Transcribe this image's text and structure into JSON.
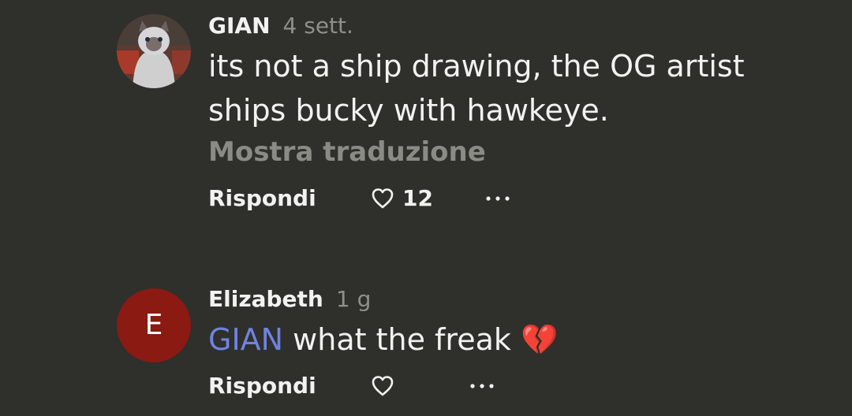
{
  "comments": [
    {
      "username": "GIAN",
      "time": "4 sett.",
      "avatar": "cat-photo",
      "body_lines": [
        "its not a ship drawing, the OG artist",
        "ships bucky with hawkeye."
      ],
      "translate": "Mostra traduzione",
      "reply_label": "Rispondi",
      "like_count": "12"
    },
    {
      "username": "Elizabeth",
      "time": "1 g",
      "avatar_letter": "E",
      "avatar_color": "#8a1a12",
      "mention": "GIAN",
      "body_text": " what the freak ",
      "emoji": "💔",
      "reply_label": "Rispondi"
    }
  ],
  "colors": {
    "background": "#2f2f2b",
    "text": "#f2f2f0",
    "muted": "#8f8f8a",
    "mention": "#6f83e0"
  }
}
